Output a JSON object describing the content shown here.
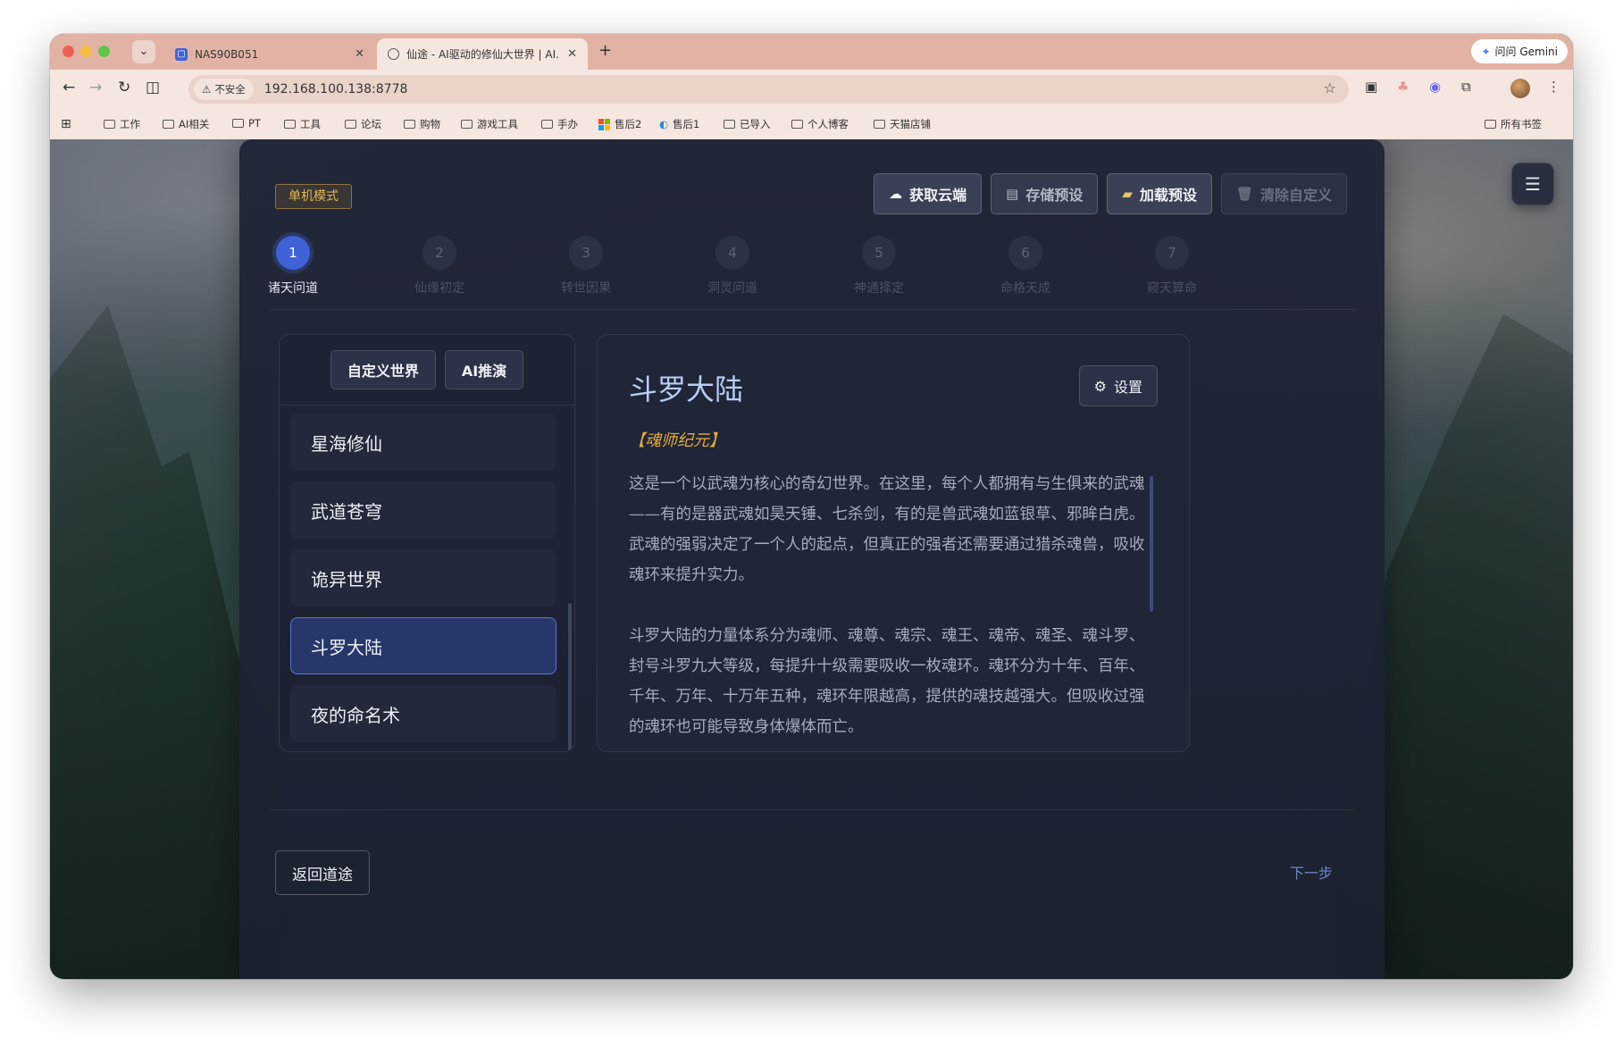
{
  "browser": {
    "tabs": [
      {
        "title": "NAS90B051"
      },
      {
        "title": "仙途 - AI驱动的修仙大世界 | AI..."
      }
    ],
    "new_tab": "+",
    "gemini": "问问 Gemini",
    "security": "不安全",
    "url": "192.168.100.138:8778",
    "bookmarks": [
      "工作",
      "AI相关",
      "PT",
      "工具",
      "论坛",
      "购物",
      "游戏工具",
      "手办",
      "售后2",
      "售后1",
      "已导入",
      "个人博客",
      "天猫店铺"
    ],
    "all_bookmarks": "所有书签"
  },
  "app": {
    "mode": "单机模式",
    "actions": {
      "fetch_cloud": "获取云端",
      "save_preset": "存储预设",
      "load_preset": "加载预设",
      "clear_custom": "清除自定义"
    },
    "steps": [
      {
        "num": "1",
        "label": "诸天问道"
      },
      {
        "num": "2",
        "label": "仙缘初定"
      },
      {
        "num": "3",
        "label": "转世因果"
      },
      {
        "num": "4",
        "label": "洞灵问道"
      },
      {
        "num": "5",
        "label": "神通择定"
      },
      {
        "num": "6",
        "label": "命格天成"
      },
      {
        "num": "7",
        "label": "窥天算命"
      }
    ],
    "list_tabs": {
      "custom": "自定义世界",
      "ai": "AI推演"
    },
    "worlds": [
      "星海修仙",
      "武道苍穹",
      "诡异世界",
      "斗罗大陆",
      "夜的命名术"
    ],
    "detail": {
      "title": "斗罗大陆",
      "settings": "设置",
      "era": "【魂师纪元】",
      "paragraphs": [
        "这是一个以武魂为核心的奇幻世界。在这里，每个人都拥有与生俱来的武魂——有的是器武魂如昊天锤、七杀剑，有的是兽武魂如蓝银草、邪眸白虎。武魂的强弱决定了一个人的起点，但真正的强者还需要通过猎杀魂兽，吸收魂环来提升实力。",
        "斗罗大陆的力量体系分为魂师、魂尊、魂宗、魂王、魂帝、魂圣、魂斗罗、封号斗罗九大等级，每提升十级需要吸收一枚魂环。魂环分为十年、百年、千年、万年、十万年五种，魂环年限越高，提供的魂技越强大。但吸收过强的魂环也可能导致身体爆体而亡。"
      ]
    },
    "back": "返回道途",
    "next": "下一步"
  }
}
